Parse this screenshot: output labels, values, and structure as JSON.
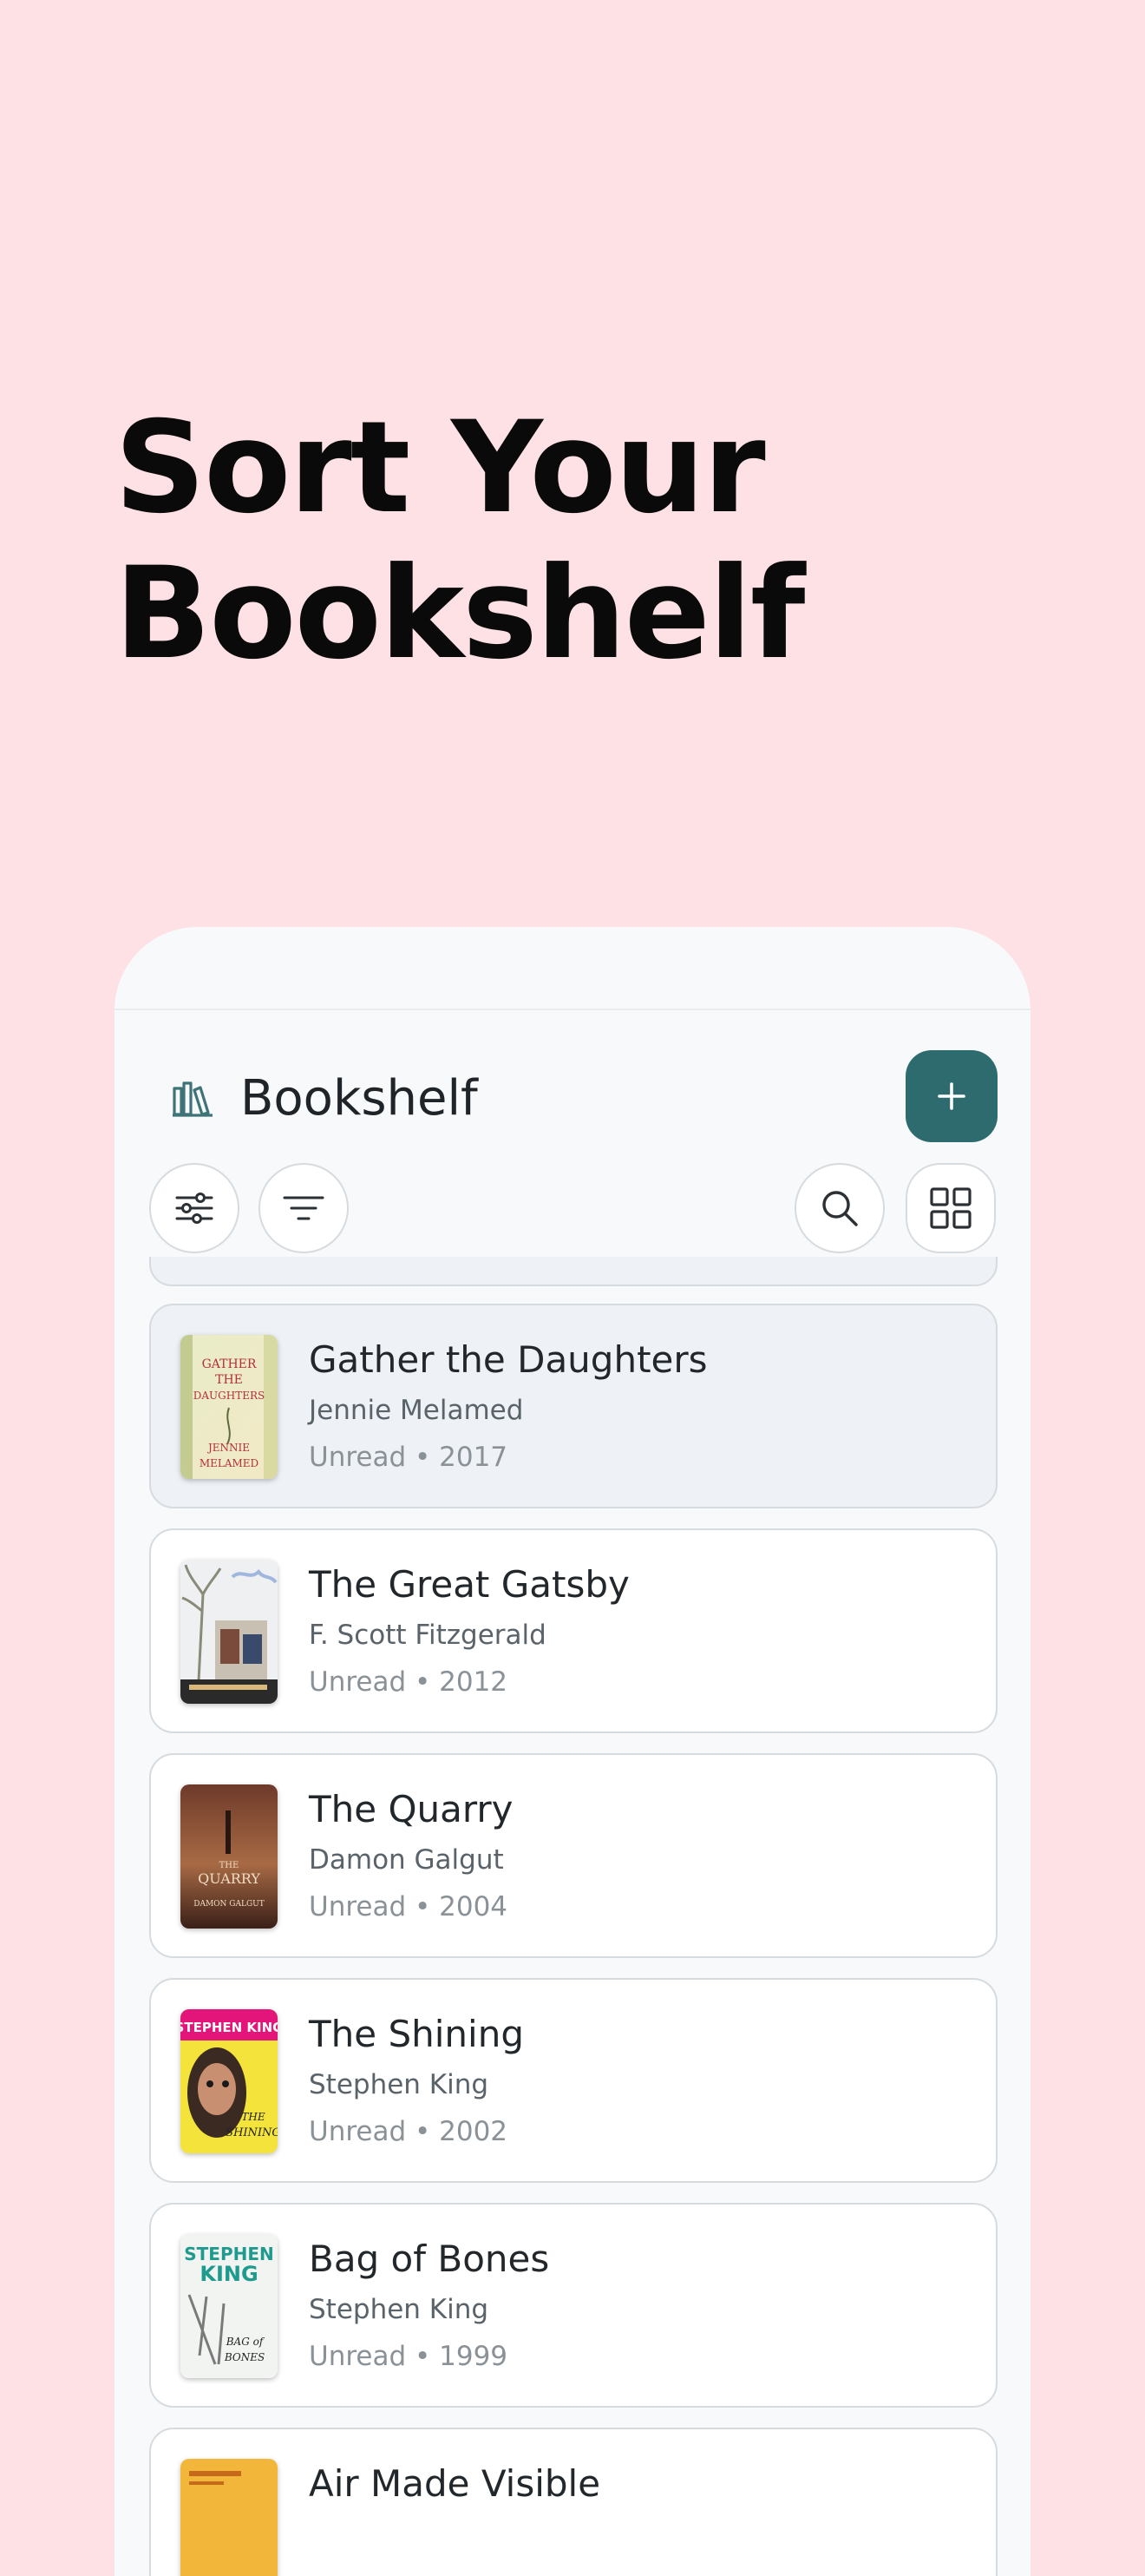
{
  "headline": {
    "line1": "Sort Your",
    "line2": "Bookshelf"
  },
  "app": {
    "title": "Bookshelf",
    "icon": "bookshelf-icon",
    "add_icon": "plus-icon",
    "accent": "#2E6B6E"
  },
  "toolbar": {
    "left": [
      "sliders-icon",
      "filter-lines-icon"
    ],
    "right": [
      "search-icon",
      "grid-view-icon"
    ]
  },
  "books": [
    {
      "title": "Gather the Daughters",
      "author": "Jennie Melamed",
      "status": "Unread",
      "year": "2017",
      "meta": "Unread • 2017",
      "cover": "Gather the Daughters cover",
      "cover_text": [
        "GATHER",
        "THE",
        "DAUGHTERS",
        "JENNIE",
        "MELAMED"
      ]
    },
    {
      "title": "The Great Gatsby",
      "author": "F. Scott Fitzgerald",
      "status": "Unread",
      "year": "2012",
      "meta": "Unread • 2012",
      "cover": "The Great Gatsby cover"
    },
    {
      "title": "The Quarry",
      "author": "Damon Galgut",
      "status": "Unread",
      "year": "2004",
      "meta": "Unread • 2004",
      "cover": "The Quarry cover",
      "cover_text": [
        "THE",
        "QUARRY",
        "DAMON GALGUT"
      ]
    },
    {
      "title": "The Shining",
      "author": "Stephen King",
      "status": "Unread",
      "year": "2002",
      "meta": "Unread • 2002",
      "cover": "The Shining cover",
      "cover_text": [
        "STEPHEN KING",
        "THE",
        "SHINING"
      ]
    },
    {
      "title": "Bag of Bones",
      "author": "Stephen King",
      "status": "Unread",
      "year": "1999",
      "meta": "Unread • 1999",
      "cover": "Bag of Bones cover",
      "cover_text": [
        "STEPHEN",
        "KING",
        "BAG of",
        "BONES"
      ]
    },
    {
      "title": "Air Made Visible",
      "cover": "Air Made Visible cover"
    }
  ]
}
